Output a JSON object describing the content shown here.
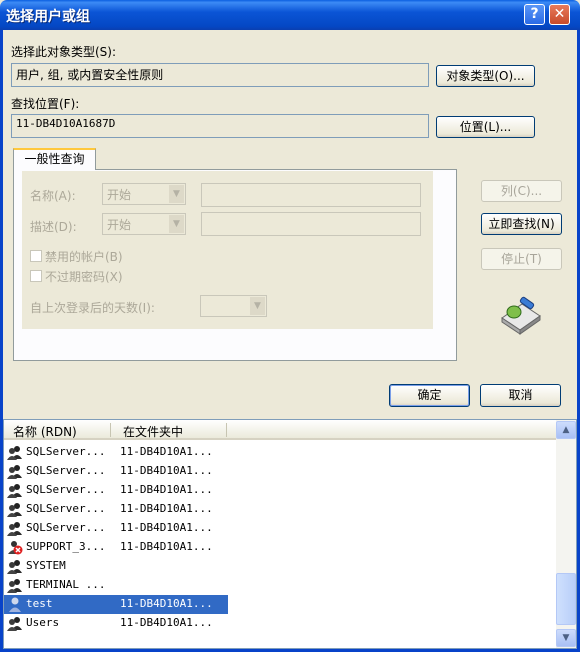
{
  "window": {
    "title": "选择用户或组",
    "help": "?",
    "close": "✕"
  },
  "object_type": {
    "label": "选择此对象类型(S):",
    "value": "用户, 组, 或内置安全性原则",
    "button": "对象类型(O)..."
  },
  "location": {
    "label": "查找位置(F):",
    "value": "11-DB4D10A1687D",
    "button": "位置(L)..."
  },
  "tab": {
    "label": "一般性查询"
  },
  "query": {
    "name_label": "名称(A):",
    "name_mode": "开始",
    "desc_label": "描述(D):",
    "desc_mode": "开始",
    "disabled_accounts": "禁用的帐户(B)",
    "no_expire_pwd": "不过期密码(X)",
    "days_since_login": "自上次登录后的天数(I):"
  },
  "side_buttons": {
    "columns": "列(C)...",
    "find_now": "立即查找(N)",
    "stop": "停止(T)"
  },
  "dialog_buttons": {
    "ok": "确定",
    "cancel": "取消"
  },
  "results": {
    "columns": [
      "名称 (RDN)",
      "在文件夹中"
    ],
    "rows": [
      {
        "name": "SQLServer...",
        "folder": "11-DB4D10A1...",
        "icon": "group-icon"
      },
      {
        "name": "SQLServer...",
        "folder": "11-DB4D10A1...",
        "icon": "group-icon"
      },
      {
        "name": "SQLServer...",
        "folder": "11-DB4D10A1...",
        "icon": "group-icon"
      },
      {
        "name": "SQLServer...",
        "folder": "11-DB4D10A1...",
        "icon": "group-icon"
      },
      {
        "name": "SQLServer...",
        "folder": "11-DB4D10A1...",
        "icon": "group-icon"
      },
      {
        "name": "SUPPORT_3...",
        "folder": "11-DB4D10A1...",
        "icon": "disabled-user-icon"
      },
      {
        "name": "SYSTEM",
        "folder": "",
        "icon": "group-icon"
      },
      {
        "name": "TERMINAL ...",
        "folder": "",
        "icon": "group-icon"
      },
      {
        "name": "test",
        "folder": "11-DB4D10A1...",
        "icon": "user-icon",
        "selected": true
      },
      {
        "name": "Users",
        "folder": "11-DB4D10A1...",
        "icon": "group-icon"
      }
    ]
  },
  "colors": {
    "titlebar": "#0a55d6",
    "selection": "#316ac5",
    "dialog_bg": "#ece9d8"
  }
}
